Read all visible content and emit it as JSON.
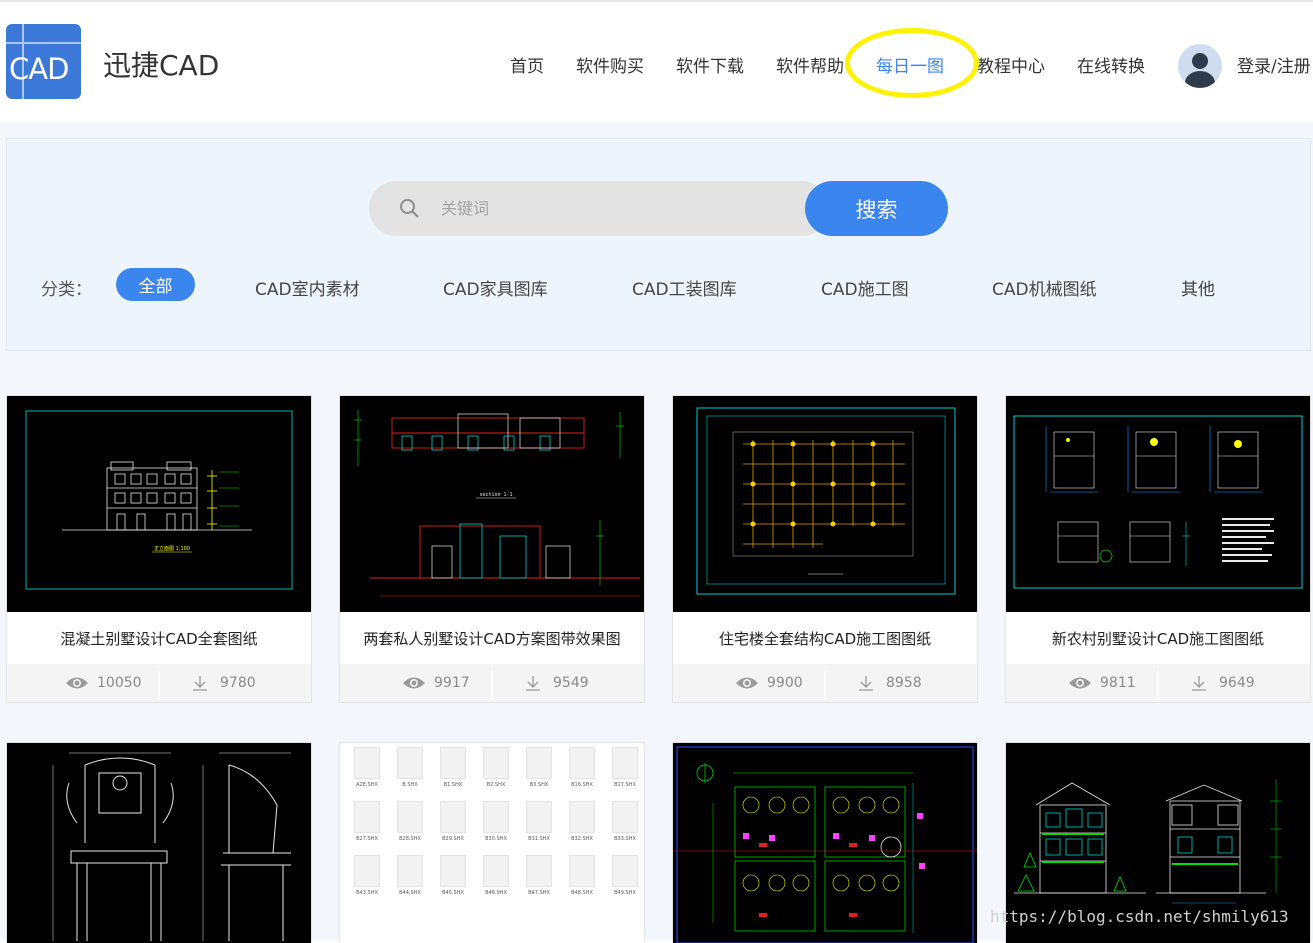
{
  "brand": {
    "logo_text": "CAD",
    "name": "迅捷CAD"
  },
  "nav": {
    "items": [
      {
        "label": "首页"
      },
      {
        "label": "软件购买"
      },
      {
        "label": "软件下载"
      },
      {
        "label": "软件帮助"
      },
      {
        "label": "每日一图",
        "active": true
      },
      {
        "label": "教程中心"
      },
      {
        "label": "在线转换"
      }
    ],
    "login_label": "登录/注册"
  },
  "search": {
    "placeholder": "关键词",
    "button_label": "搜索"
  },
  "categories": {
    "label": "分类：",
    "items": [
      {
        "label": "全部",
        "selected": true
      },
      {
        "label": "CAD室内素材"
      },
      {
        "label": "CAD家具图库"
      },
      {
        "label": "CAD工装图库"
      },
      {
        "label": "CAD施工图"
      },
      {
        "label": "CAD机械图纸"
      },
      {
        "label": "其他"
      }
    ]
  },
  "cards": [
    {
      "title": "混凝土别墅设计CAD全套图纸",
      "views": "10050",
      "downloads": "9780",
      "thumb_caption": "正立面图 1:100"
    },
    {
      "title": "两套私人别墅设计CAD方案图带效果图",
      "views": "9917",
      "downloads": "9549",
      "thumb_caption": "section 1-1"
    },
    {
      "title": "住宅楼全套结构CAD施工图图纸",
      "views": "9900",
      "downloads": "8958",
      "thumb_caption": ""
    },
    {
      "title": "新农村别墅设计CAD施工图图纸",
      "views": "9811",
      "downloads": "9649",
      "thumb_caption": ""
    },
    {
      "title": "",
      "views": "",
      "downloads": "",
      "thumb_caption": ""
    },
    {
      "title": "",
      "views": "",
      "downloads": "",
      "thumb_caption": "",
      "files": [
        "A2E.SHX",
        "B.SHX",
        "B1.SHX",
        "B2.SHX",
        "B3.SHX",
        "B16.SHX",
        "B17.SHX",
        "B27.SHX",
        "B28.SHX",
        "B29.SHX",
        "B30.SHX",
        "B31.SHX",
        "B32.SHX",
        "B33.SHX",
        "B43.SHX",
        "B44.SHX",
        "B45.SHX",
        "B46.SHX",
        "B47.SHX",
        "B48.SHX",
        "B49.SHX"
      ]
    },
    {
      "title": "",
      "views": "",
      "downloads": "",
      "thumb_caption": ""
    },
    {
      "title": "",
      "views": "",
      "downloads": "",
      "thumb_caption": ""
    }
  ],
  "watermark": "https://blog.csdn.net/shmily613",
  "colors": {
    "accent": "#3a86ee",
    "highlight": "#fff200",
    "cad_bg": "#000000"
  }
}
